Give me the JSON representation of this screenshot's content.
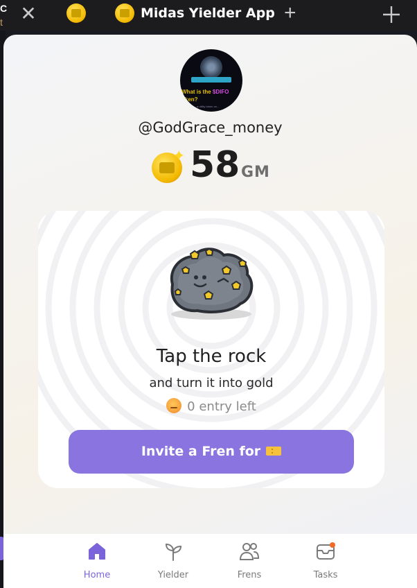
{
  "window": {
    "title": "Midas Yielder App",
    "edge_letters": [
      "C",
      "t"
    ]
  },
  "profile": {
    "username": "@GodGrace_money",
    "avatar_text_line1": "What is the",
    "avatar_text_highlight": "$DIFO",
    "avatar_text_line2": "oken?",
    "avatar_small_text": "a utility token on..."
  },
  "balance": {
    "value": "58",
    "unit": "GM"
  },
  "card": {
    "title": "Tap the rock",
    "subtitle": "and turn it into gold",
    "entries_text": "0 entry left",
    "invite_label": "Invite a Fren for"
  },
  "nav": {
    "items": [
      {
        "label": "Home",
        "icon": "home-icon",
        "active": true
      },
      {
        "label": "Yielder",
        "icon": "sprout-icon",
        "active": false
      },
      {
        "label": "Frens",
        "icon": "users-icon",
        "active": false
      },
      {
        "label": "Tasks",
        "icon": "mail-icon",
        "active": false,
        "badge": true
      }
    ]
  },
  "colors": {
    "accent": "#8a74e0",
    "nav_active": "#7b64d9",
    "coin_gold": "#f3b900",
    "badge": "#f06a2a"
  }
}
